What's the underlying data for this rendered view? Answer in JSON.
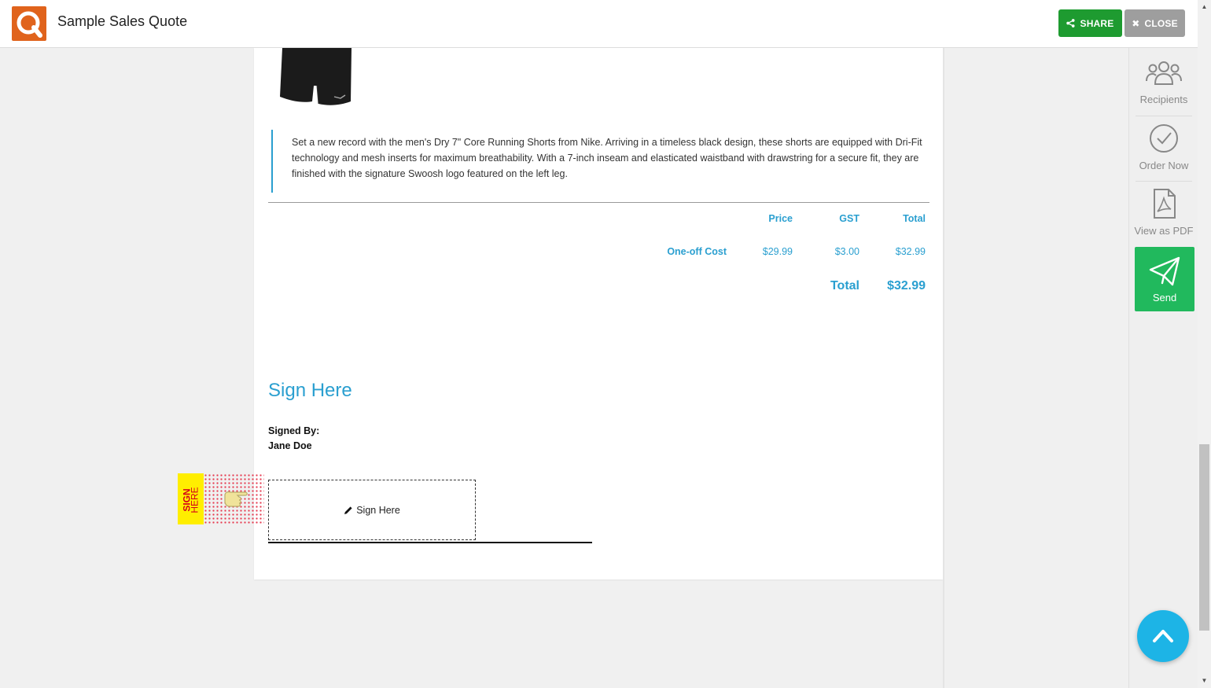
{
  "header": {
    "title": "Sample Sales Quote",
    "share_label": "SHARE",
    "close_label": "CLOSE",
    "share_icon": "share-icon",
    "close_icon": "close-icon"
  },
  "document": {
    "description": "Set a new record with the men's Dry 7\" Core Running Shorts from Nike. Arriving in a timeless black design, these shorts are equipped with Dri-Fit technology and mesh inserts for maximum breathability. With a 7-inch inseam and elasticated waistband with drawstring for a secure fit, they are finished with the signature Swoosh logo featured on the left leg.",
    "pricing": {
      "headers": {
        "price": "Price",
        "gst": "GST",
        "total": "Total"
      },
      "row": {
        "label": "One-off Cost",
        "price": "$29.99",
        "gst": "$3.00",
        "total": "$32.99"
      },
      "total_label": "Total",
      "total_value": "$32.99"
    },
    "signature": {
      "heading": "Sign Here",
      "signed_by_label": "Signed By:",
      "signer_name": "Jane Doe",
      "box_label": "Sign Here",
      "tag_line1": "SIGN",
      "tag_line2": "HERE"
    }
  },
  "sidebar": {
    "recipients": "Recipients",
    "order_now": "Order Now",
    "view_pdf": "View as PDF",
    "send": "Send"
  },
  "colors": {
    "accent": "#2a9fd0",
    "share": "#1e9b30",
    "close": "#9e9e9e",
    "send": "#21b95d",
    "logo": "#e0631c",
    "fab": "#1db4e6"
  }
}
